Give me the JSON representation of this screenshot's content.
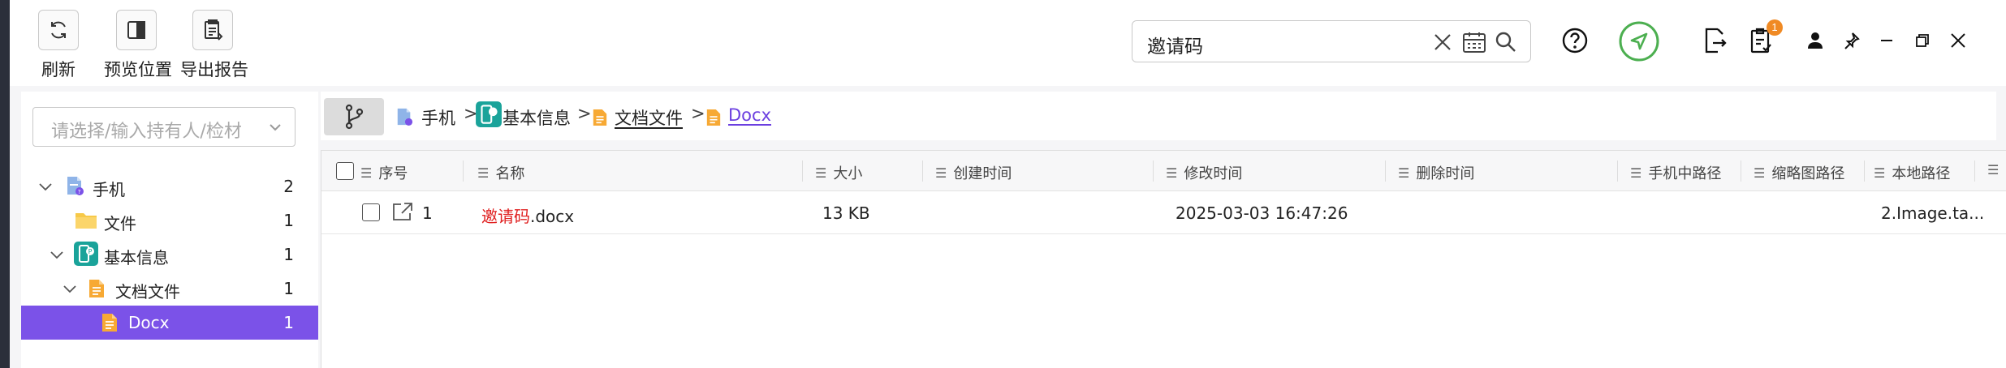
{
  "toolbar": {
    "refresh_label": "刷新",
    "preview_label": "预览位置",
    "export_label": "导出报告"
  },
  "search": {
    "value": "邀请码"
  },
  "header_icons": {
    "notification_badge": "1",
    "accent_color": "#4caf50"
  },
  "left_panel": {
    "owner_placeholder": "请选择/输入持有人/检材",
    "tree": [
      {
        "label": "手机",
        "count": "2"
      },
      {
        "label": "文件",
        "count": "1"
      },
      {
        "label": "基本信息",
        "count": "1"
      },
      {
        "label": "文档文件",
        "count": "1"
      },
      {
        "label": "Docx",
        "count": "1"
      }
    ],
    "active_color": "#7b52e8"
  },
  "breadcrumb": {
    "items": [
      "手机",
      "基本信息",
      "文档文件",
      "Docx"
    ],
    "separator": ">"
  },
  "table": {
    "columns": [
      "序号",
      "名称",
      "大小",
      "创建时间",
      "修改时间",
      "删除时间",
      "手机中路径",
      "缩略图路径",
      "本地路径"
    ],
    "rows": [
      {
        "index": "1",
        "name_highlight": "邀请码",
        "name_rest": ".docx",
        "size": "13 KB",
        "created": "",
        "modified": "2025-03-03 16:47:26",
        "deleted": "",
        "phone_path": "",
        "thumb_path": "",
        "local_path": "2.Image.ta..."
      }
    ]
  }
}
